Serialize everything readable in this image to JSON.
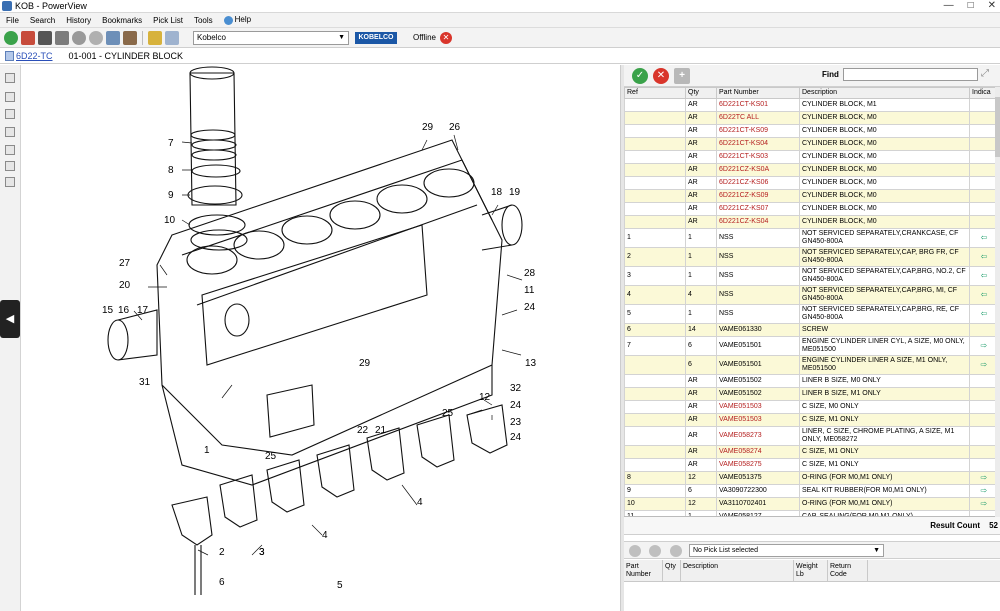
{
  "window": {
    "title": "KOB - PowerView",
    "controls": [
      "—",
      "□",
      "✕"
    ]
  },
  "menu": {
    "items": [
      "File",
      "Search",
      "History",
      "Bookmarks",
      "Pick List",
      "Tools"
    ],
    "help": "Help"
  },
  "toolbar": {
    "brand_value": "Kobelco",
    "brand_logo": "KOBELCO",
    "status_label": "Offline"
  },
  "breadcrumb": {
    "model": "6D22-TC",
    "section": "01-001 - CYLINDER BLOCK"
  },
  "drawing": {
    "callouts": [
      "7",
      "8",
      "9",
      "10",
      "29",
      "26",
      "18",
      "19",
      "27",
      "20",
      "15",
      "16",
      "17",
      "11",
      "28",
      "24",
      "13",
      "29",
      "31",
      "32",
      "12",
      "24",
      "25",
      "22",
      "21",
      "23",
      "25",
      "24",
      "3",
      "4",
      "4",
      "2",
      "3",
      "6",
      "5",
      "1"
    ]
  },
  "parts_panel": {
    "find_label": "Find",
    "find_value": "",
    "columns": [
      "Ref",
      "Qty",
      "Part Number",
      "Description",
      "Indica"
    ],
    "rows": [
      {
        "ref": "",
        "qty": "AR",
        "part": "6D221CT-KS01",
        "desc": "CYLINDER BLOCK, M1",
        "ind": "",
        "red": true,
        "tint": "white",
        "tall": false
      },
      {
        "ref": "",
        "qty": "AR",
        "part": "6D22TC ALL",
        "desc": "CYLINDER BLOCK, M0",
        "ind": "",
        "red": true,
        "tint": "yellow",
        "tall": false
      },
      {
        "ref": "",
        "qty": "AR",
        "part": "6D221CT-KS09",
        "desc": "CYLINDER BLOCK, M0",
        "ind": "",
        "red": true,
        "tint": "white",
        "tall": false
      },
      {
        "ref": "",
        "qty": "AR",
        "part": "6D221CT-KS04",
        "desc": "CYLINDER BLOCK, M0",
        "ind": "",
        "red": true,
        "tint": "yellow",
        "tall": false
      },
      {
        "ref": "",
        "qty": "AR",
        "part": "6D221CT-KS03",
        "desc": "CYLINDER BLOCK, M0",
        "ind": "",
        "red": true,
        "tint": "white",
        "tall": false
      },
      {
        "ref": "",
        "qty": "AR",
        "part": "6D221CZ-KS0A",
        "desc": "CYLINDER BLOCK, M0",
        "ind": "",
        "red": true,
        "tint": "yellow",
        "tall": false
      },
      {
        "ref": "",
        "qty": "AR",
        "part": "6D221CZ-KS06",
        "desc": "CYLINDER BLOCK, M0",
        "ind": "",
        "red": true,
        "tint": "white",
        "tall": false
      },
      {
        "ref": "",
        "qty": "AR",
        "part": "6D221CZ-KS09",
        "desc": "CYLINDER BLOCK, M0",
        "ind": "",
        "red": true,
        "tint": "yellow",
        "tall": false
      },
      {
        "ref": "",
        "qty": "AR",
        "part": "6D221CZ-KS07",
        "desc": "CYLINDER BLOCK, M0",
        "ind": "",
        "red": true,
        "tint": "white",
        "tall": false
      },
      {
        "ref": "",
        "qty": "AR",
        "part": "6D221CZ-KS04",
        "desc": "CYLINDER BLOCK, M0",
        "ind": "",
        "red": true,
        "tint": "yellow",
        "tall": false
      },
      {
        "ref": "1",
        "qty": "1",
        "part": "NSS",
        "desc": "NOT SERVICED SEPARATELY,CRANKCASE, CF GN450-800A",
        "ind": "⇦",
        "red": false,
        "tint": "white",
        "tall": true
      },
      {
        "ref": "2",
        "qty": "1",
        "part": "NSS",
        "desc": "NOT SERVICED SEPARATELY,CAP, BRG FR, CF GN450-800A",
        "ind": "⇦",
        "red": false,
        "tint": "yellow",
        "tall": true
      },
      {
        "ref": "3",
        "qty": "1",
        "part": "NSS",
        "desc": "NOT SERVICED SEPARATELY,CAP,BRG, NO.2, CF GN450-800A",
        "ind": "⇦",
        "red": false,
        "tint": "white",
        "tall": true
      },
      {
        "ref": "4",
        "qty": "4",
        "part": "NSS",
        "desc": "NOT SERVICED SEPARATELY,CAP,BRG, MI, CF GN450-800A",
        "ind": "⇦",
        "red": false,
        "tint": "yellow",
        "tall": true
      },
      {
        "ref": "5",
        "qty": "1",
        "part": "NSS",
        "desc": "NOT SERVICED SEPARATELY,CAP,BRG, RE, CF GN450-800A",
        "ind": "⇦",
        "red": false,
        "tint": "white",
        "tall": true
      },
      {
        "ref": "6",
        "qty": "14",
        "part": "VAME061330",
        "desc": "SCREW",
        "ind": "",
        "red": false,
        "tint": "yellow",
        "tall": false
      },
      {
        "ref": "7",
        "qty": "6",
        "part": "VAME051501",
        "desc": "ENGINE CYLINDER LINER CYL, A SIZE, M0 ONLY, ME051500",
        "ind": "⇨",
        "red": false,
        "tint": "white",
        "tall": true
      },
      {
        "ref": "",
        "qty": "6",
        "part": "VAME051501",
        "desc": "ENGINE CYLINDER LINER A SIZE, M1 ONLY, ME051500",
        "ind": "⇨",
        "red": false,
        "tint": "yellow",
        "tall": true
      },
      {
        "ref": "",
        "qty": "AR",
        "part": "VAME051502",
        "desc": "LINER B SIZE, M0 ONLY",
        "ind": "",
        "red": false,
        "tint": "white",
        "tall": false
      },
      {
        "ref": "",
        "qty": "AR",
        "part": "VAME051502",
        "desc": "LINER B SIZE, M1 ONLY",
        "ind": "",
        "red": false,
        "tint": "yellow",
        "tall": false
      },
      {
        "ref": "",
        "qty": "AR",
        "part": "VAME051503",
        "desc": "C SIZE, M0 ONLY",
        "ind": "",
        "red": true,
        "tint": "white",
        "tall": false
      },
      {
        "ref": "",
        "qty": "AR",
        "part": "VAME051503",
        "desc": "C SIZE, M1 ONLY",
        "ind": "",
        "red": true,
        "tint": "yellow",
        "tall": false
      },
      {
        "ref": "",
        "qty": "AR",
        "part": "VAME058273",
        "desc": "LINER, C SIZE, CHROME PLATING, A SIZE, M1 ONLY, ME058272",
        "ind": "",
        "red": true,
        "tint": "white",
        "tall": true
      },
      {
        "ref": "",
        "qty": "AR",
        "part": "VAME058274",
        "desc": "C SIZE, M1 ONLY",
        "ind": "",
        "red": true,
        "tint": "yellow",
        "tall": false
      },
      {
        "ref": "",
        "qty": "AR",
        "part": "VAME058275",
        "desc": "C SIZE, M1 ONLY",
        "ind": "",
        "red": true,
        "tint": "white",
        "tall": false
      },
      {
        "ref": "8",
        "qty": "12",
        "part": "VAME051375",
        "desc": "O-RING (FOR M0,M1 ONLY)",
        "ind": "⇨",
        "red": false,
        "tint": "yellow",
        "tall": false
      },
      {
        "ref": "9",
        "qty": "6",
        "part": "VA3090722300",
        "desc": "SEAL KIT RUBBER(FOR M0,M1 ONLY)",
        "ind": "⇨",
        "red": false,
        "tint": "white",
        "tall": false
      },
      {
        "ref": "10",
        "qty": "12",
        "part": "VA3110702401",
        "desc": "O-RING (FOR M0,M1 ONLY)",
        "ind": "⇨",
        "red": false,
        "tint": "yellow",
        "tall": false
      },
      {
        "ref": "11",
        "qty": "1",
        "part": "VAME058127",
        "desc": "CAP, SEALING(FOR M0,M1 ONLY)",
        "ind": "",
        "red": false,
        "tint": "white",
        "tall": false
      }
    ],
    "result_label": "Result Count",
    "result_count": "52"
  },
  "picklist": {
    "selected": "No Pick List selected",
    "columns": [
      "Part Number",
      "Qty",
      "Description",
      "Weight Lb",
      "Return Code"
    ]
  },
  "colors": {
    "accent": "#2a4fb8",
    "part_red": "#b52020",
    "row_tint": "#fbf9d7",
    "indicator": "#1f9e6d"
  }
}
